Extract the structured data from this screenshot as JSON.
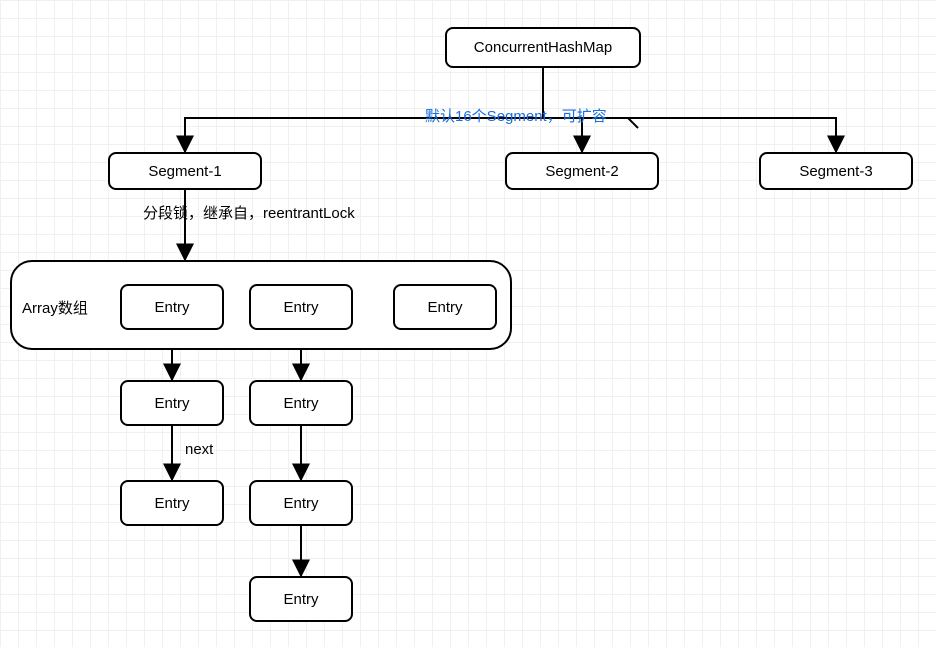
{
  "nodes": {
    "root": "ConcurrentHashMap",
    "seg1": "Segment-1",
    "seg2": "Segment-2",
    "seg3": "Segment-3",
    "arrayLabel": "Array数组",
    "entry": "Entry"
  },
  "annotations": {
    "defaultSegments": "默认16个Segment，可扩容",
    "segmentLock": "分段锁，继承自，reentrantLock",
    "next": "next"
  }
}
